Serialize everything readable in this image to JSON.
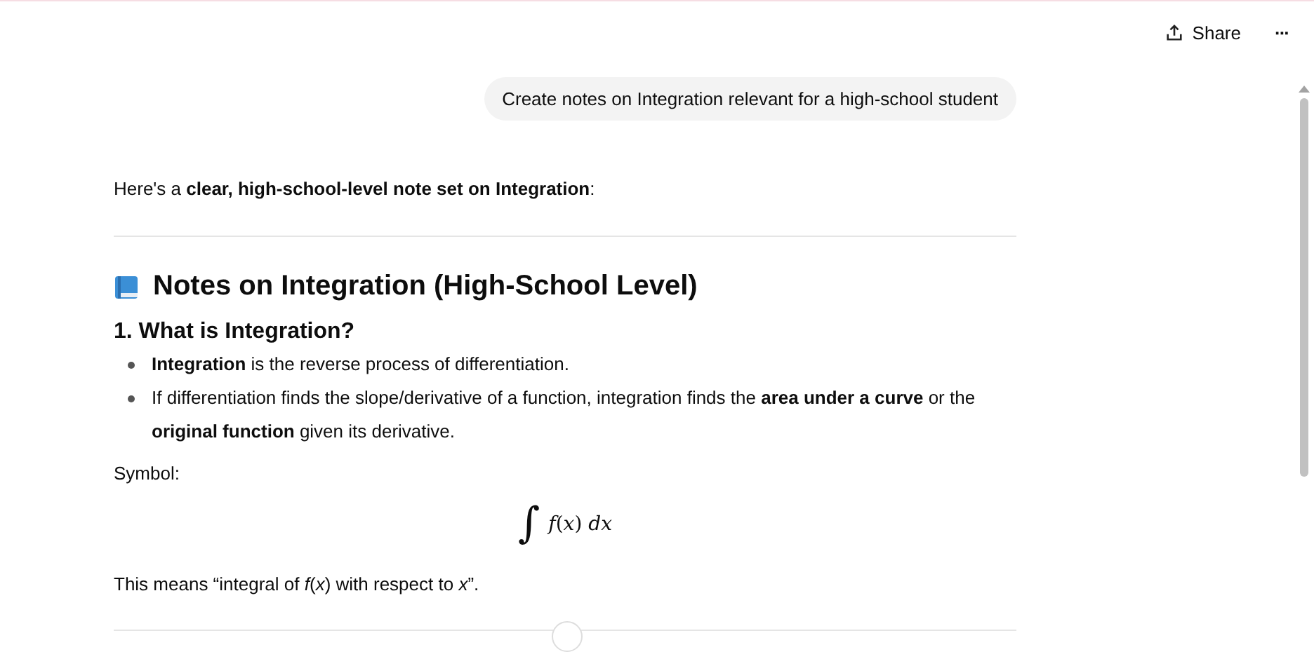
{
  "header": {
    "share_label": "Share",
    "more_label": "···"
  },
  "user_message": "Create notes on Integration relevant for a high-school student",
  "reply": {
    "intro": "Here's a **clear, high-school-level note set on Integration**:",
    "title": "Notes on Integration (High-School Level)",
    "section": "1. What is Integration?",
    "bullets": [
      "**Integration** is the reverse process of differentiation.",
      "If differentiation finds the slope/derivative of a function, integration finds the **area under a curve** or the **original function** given its derivative."
    ],
    "symbol_label": "Symbol:",
    "formula": {
      "sign": "∫",
      "body": "*f*(*x*) *dx*"
    },
    "meaning": "This means “integral of *f*(*x*) with respect to *x*”."
  }
}
